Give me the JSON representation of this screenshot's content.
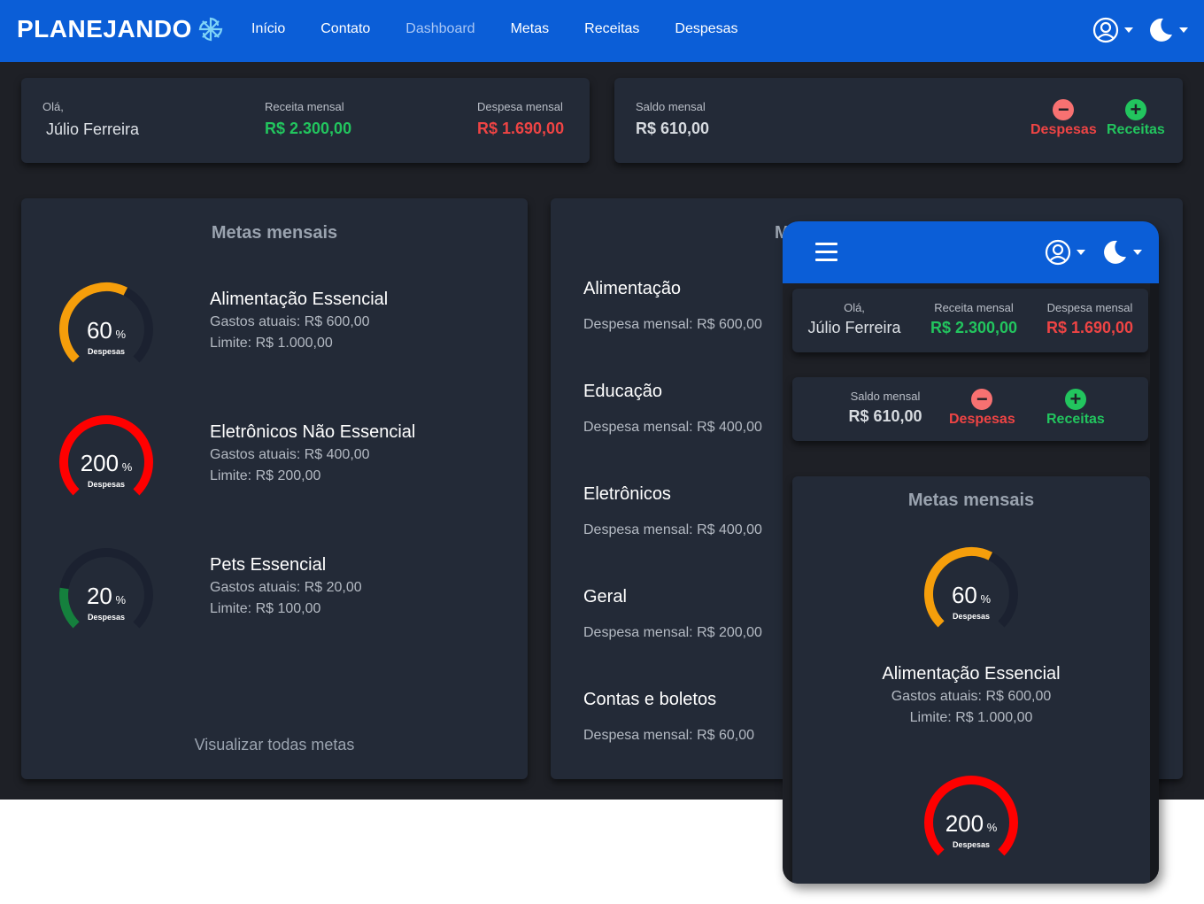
{
  "brand": "PLANEJANDO",
  "nav": [
    "Início",
    "Contato",
    "Dashboard",
    "Metas",
    "Receitas",
    "Despesas"
  ],
  "nav_active": "Dashboard",
  "summary": {
    "greeting": "Olá,",
    "user": "Júlio Ferreira",
    "income_label": "Receita mensal",
    "income_value": "R$ 2.300,00",
    "expense_label": "Despesa mensal",
    "expense_value": "R$ 1.690,00",
    "balance_label": "Saldo mensal",
    "balance_value": "R$ 610,00",
    "btn_expenses": "Despesas",
    "btn_income": "Receitas"
  },
  "goals": {
    "title": "Metas mensais",
    "caption": "Despesas",
    "view_all": "Visualizar todas metas",
    "items": [
      {
        "name": "Alimentação Essencial",
        "spent": "Gastos atuais: R$ 600,00",
        "limit": "Limite: R$ 1.000,00",
        "percent": 60,
        "color": "#f59e0b"
      },
      {
        "name": "Eletrônicos Não Essencial",
        "spent": "Gastos atuais: R$ 400,00",
        "limit": "Limite: R$ 200,00",
        "percent": 200,
        "color": "#ff0000"
      },
      {
        "name": "Pets Essencial",
        "spent": "Gastos atuais: R$ 20,00",
        "limit": "Limite: R$ 100,00",
        "percent": 20,
        "color": "#15803d"
      }
    ]
  },
  "categories": {
    "title_partial": "M",
    "items": [
      {
        "name": "Alimentação",
        "value": "Despesa mensal: R$ 600,00"
      },
      {
        "name": "Educação",
        "value": "Despesa mensal: R$ 400,00"
      },
      {
        "name": "Eletrônicos",
        "value": "Despesa mensal: R$ 400,00"
      },
      {
        "name": "Geral",
        "value": "Despesa mensal: R$ 200,00"
      },
      {
        "name": "Contas e boletos",
        "value": "Despesa mensal: R$ 60,00"
      }
    ]
  },
  "icons": {
    "logo": "swirl-logo-icon",
    "user": "user-circle-icon",
    "theme": "moon-icon",
    "menu": "hamburger-menu-icon",
    "minus": "minus-circle-icon",
    "plus": "plus-circle-icon"
  }
}
